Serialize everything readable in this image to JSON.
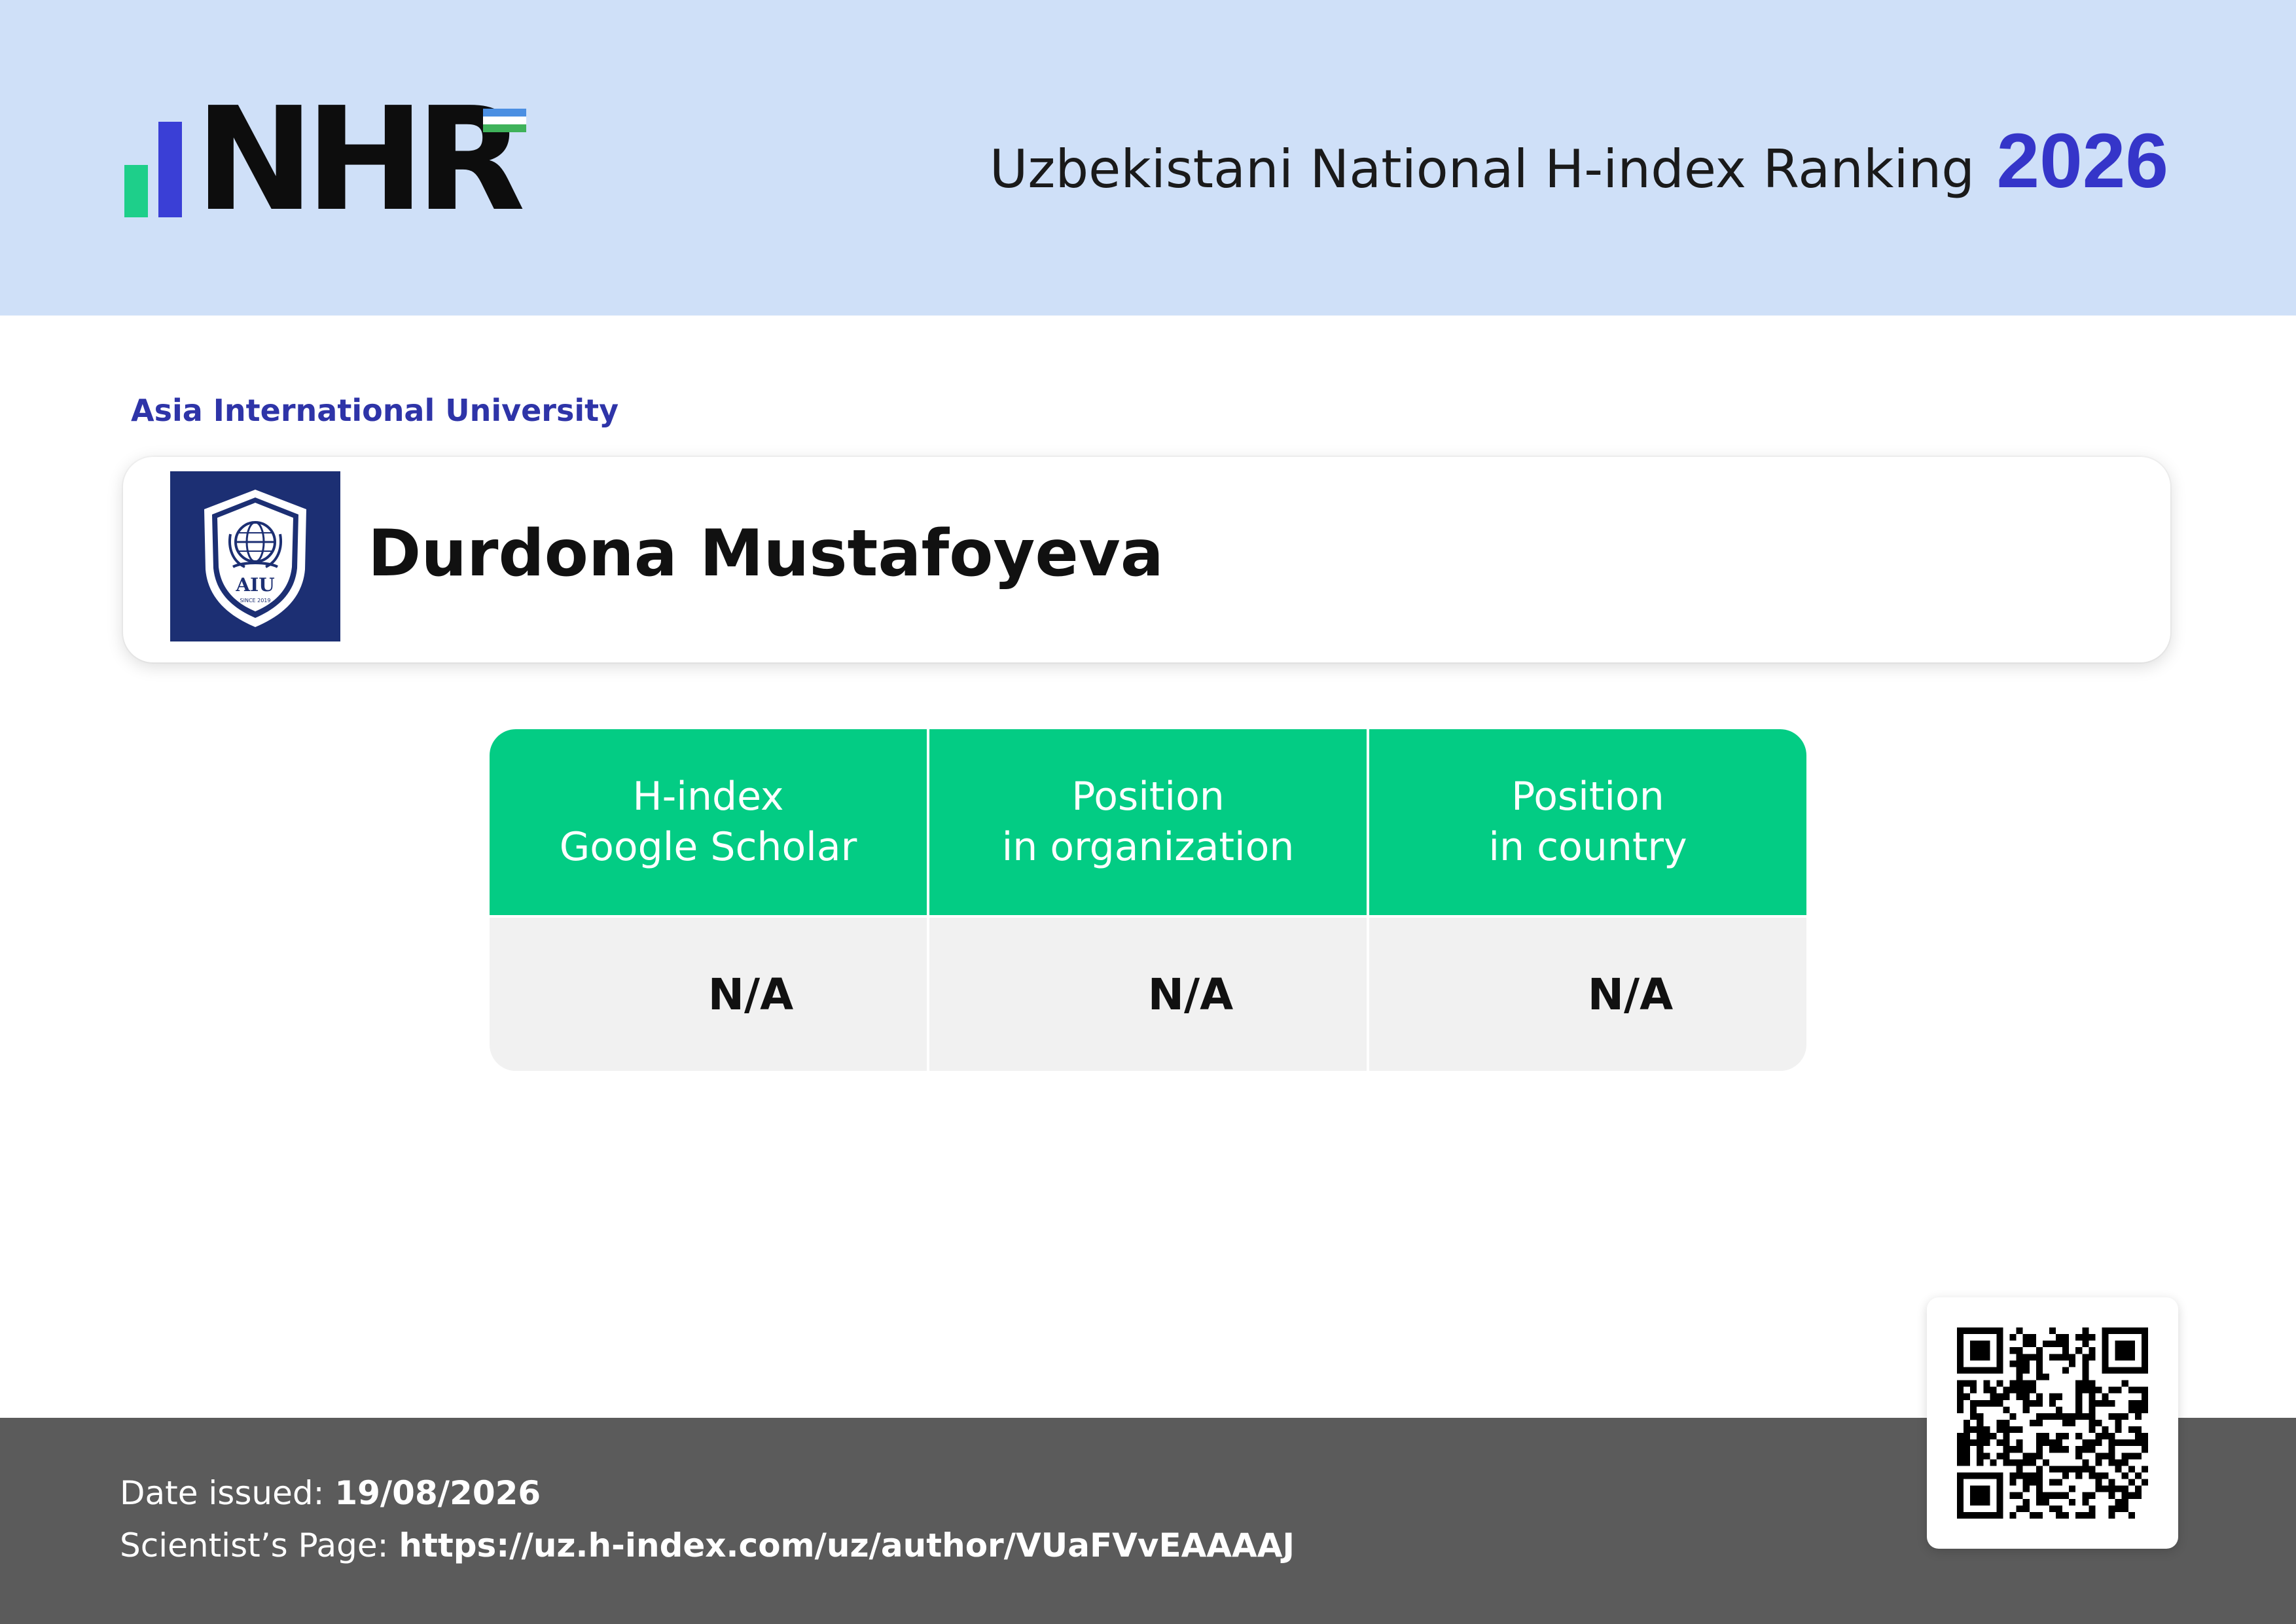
{
  "header": {
    "logo_text": "NHR",
    "title": "Uzbekistani National H-index Ranking",
    "year": "2026",
    "colors": {
      "background": "#cfe0f8",
      "year": "#3535c9",
      "logo_bar_green": "#1ecf8a",
      "logo_bar_blue": "#3a3fd6"
    }
  },
  "organization": {
    "name": "Asia International University",
    "logo_icon": "aiu-crest-icon",
    "logo_text": "AIU",
    "logo_subtext": "SINCE 2019"
  },
  "person": {
    "name": "Durdona Mustafoyeva"
  },
  "stats": {
    "columns": [
      {
        "label_line1": "H-index",
        "label_line2": "Google Scholar",
        "value": "N/A"
      },
      {
        "label_line1": "Position",
        "label_line2": "in organization",
        "value": "N/A"
      },
      {
        "label_line1": "Position",
        "label_line2": "in country",
        "value": "N/A"
      }
    ],
    "colors": {
      "header": "#03cc84",
      "body": "#f1f1f1"
    }
  },
  "footer": {
    "date_label": "Date issued:",
    "date_value": "19/08/2026",
    "page_label": "Scientist’s Page:",
    "page_url": "https://uz.h-index.com/uz/author/VUaFVvEAAAAJ",
    "qr_icon": "qr-code-icon",
    "colors": {
      "background": "#5b5b5b"
    }
  }
}
